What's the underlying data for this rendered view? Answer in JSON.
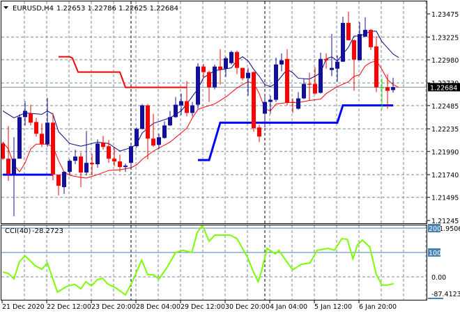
{
  "header": {
    "symbol": "EURUSD,H4",
    "ohlc": "1.22653 1.22786 1.22625 1.22684"
  },
  "chart_data": [
    {
      "type": "candlestick",
      "title": "EURUSD,H4",
      "ylim": [
        1.21245,
        1.23475
      ],
      "price_ticks": [
        "1.23475",
        "1.23225",
        "1.22980",
        "1.22730",
        "1.22485",
        "1.22235",
        "1.21990",
        "1.21740",
        "1.21495",
        "1.21245"
      ],
      "current_price": "1.22684",
      "time_labels": [
        "21 Dec 2020",
        "22 Dec 12:00",
        "23 Dec 20:00",
        "28 Dec 04:00",
        "29 Dec 12:00",
        "30 Dec 20:00",
        "4 Jan 04:00",
        "5 Jan 12:00",
        "6 Jan 20:00"
      ],
      "colors": {
        "bull": "#10109c",
        "bear": "#ff0000",
        "doji": "#33dd22",
        "upper_line": "#000080",
        "lower_line": "#ff0000",
        "step_blue": "#0000ff",
        "step_red": "#ff0000",
        "current": "#7f8fa0"
      },
      "candles": [
        [
          1.22076,
          1.22091,
          1.21897,
          1.21912
        ],
        [
          1.21912,
          1.22264,
          1.21673,
          1.21748
        ],
        [
          1.21748,
          1.22144,
          1.21291,
          1.21912
        ],
        [
          1.21912,
          1.22391,
          1.21912,
          1.22361
        ],
        [
          1.22361,
          1.22533,
          1.22271,
          1.22428
        ],
        [
          1.22398,
          1.22495,
          1.22271,
          1.22301
        ],
        [
          1.22308,
          1.22353,
          1.22151,
          1.22181
        ],
        [
          1.22181,
          1.22293,
          1.22039,
          1.22069
        ],
        [
          1.22069,
          1.2257,
          1.22039,
          1.22301
        ],
        [
          1.22301,
          1.22406,
          1.2168,
          1.2174
        ],
        [
          1.2174,
          1.2174,
          1.21516,
          1.2162
        ],
        [
          1.21605,
          1.21778,
          1.21531,
          1.2177
        ],
        [
          1.2177,
          1.21905,
          1.2174,
          1.2189
        ],
        [
          1.2189,
          1.22009,
          1.21852,
          1.21935
        ],
        [
          1.21935,
          1.21979,
          1.21605,
          1.21763
        ],
        [
          1.21763,
          1.22211,
          1.21733,
          1.21867
        ],
        [
          1.21867,
          1.21964,
          1.21733,
          1.21852
        ],
        [
          1.21852,
          1.22121,
          1.21815,
          1.22076
        ],
        [
          1.22084,
          1.22159,
          1.22009,
          1.22039
        ],
        [
          1.22047,
          1.22114,
          1.21867,
          1.21912
        ],
        [
          1.21912,
          1.22032,
          1.2183,
          1.21882
        ],
        [
          1.21882,
          1.21957,
          1.2177,
          1.21822
        ],
        [
          1.21822,
          1.2186,
          1.2177,
          1.21837
        ],
        [
          1.21867,
          1.22054,
          1.21807,
          1.22047
        ],
        [
          1.22047,
          1.22249,
          1.22032,
          1.22234
        ],
        [
          1.22234,
          1.22503,
          1.22226,
          1.22488
        ],
        [
          1.22488,
          1.22503,
          1.21905,
          1.22129
        ],
        [
          1.22129,
          1.22398,
          1.22039,
          1.22054
        ],
        [
          1.22062,
          1.22181,
          1.22017,
          1.22144
        ],
        [
          1.22136,
          1.22316,
          1.22129,
          1.22271
        ],
        [
          1.22271,
          1.22428,
          1.22264,
          1.22361
        ],
        [
          1.22361,
          1.22578,
          1.22353,
          1.22495
        ],
        [
          1.22488,
          1.22615,
          1.22383,
          1.22533
        ],
        [
          1.22533,
          1.2275,
          1.22368,
          1.22406
        ],
        [
          1.22406,
          1.22525,
          1.22368,
          1.22488
        ],
        [
          1.22495,
          1.22944,
          1.22451,
          1.22907
        ],
        [
          1.22907,
          1.22937,
          1.2278,
          1.22847
        ],
        [
          1.22847,
          1.22862,
          1.22525,
          1.22682
        ],
        [
          1.22682,
          1.22929,
          1.2266,
          1.22907
        ],
        [
          1.22907,
          1.23094,
          1.22712,
          1.22877
        ],
        [
          1.22884,
          1.23012,
          1.22795,
          1.22997
        ],
        [
          1.22944,
          1.23079,
          1.22929,
          1.23064
        ],
        [
          1.23064,
          1.23079,
          1.22825,
          1.22892
        ],
        [
          1.22892,
          1.22892,
          1.22757,
          1.2278
        ],
        [
          1.2278,
          1.22892,
          1.22593,
          1.2284
        ],
        [
          1.22847,
          1.22855,
          1.22204,
          1.22241
        ],
        [
          1.22249,
          1.22279,
          1.22091,
          1.22151
        ],
        [
          1.22398,
          1.22578,
          1.22249,
          1.22525
        ],
        [
          1.22525,
          1.22593,
          1.22398,
          1.22548
        ],
        [
          1.22548,
          1.23004,
          1.22525,
          1.22929
        ],
        [
          1.22929,
          1.23049,
          1.22855,
          1.22974
        ],
        [
          1.22989,
          1.23094,
          1.22488,
          1.22518
        ],
        [
          1.22525,
          1.22563,
          1.22406,
          1.22518
        ],
        [
          1.22451,
          1.2263,
          1.22443,
          1.22563
        ],
        [
          1.22563,
          1.22772,
          1.22555,
          1.2272
        ],
        [
          1.2272,
          1.2284,
          1.2254,
          1.22712
        ],
        [
          1.2272,
          1.22899,
          1.22608,
          1.22615
        ],
        [
          1.22623,
          1.23057,
          1.22615,
          1.22989
        ],
        [
          1.22989,
          1.23049,
          1.22884,
          1.22974
        ],
        [
          1.2287,
          1.23258,
          1.22802,
          1.22892
        ],
        [
          1.22884,
          1.23027,
          1.22742,
          1.22959
        ],
        [
          1.22959,
          1.23445,
          1.22959,
          1.23378
        ],
        [
          1.23378,
          1.23498,
          1.23191,
          1.23191
        ],
        [
          1.23191,
          1.23199,
          1.22645,
          1.22982
        ],
        [
          1.22974,
          1.23386,
          1.22974,
          1.23258
        ],
        [
          1.23229,
          1.23438,
          1.23229,
          1.23303
        ],
        [
          1.23303,
          1.23311,
          1.23086,
          1.23116
        ],
        [
          1.23124,
          1.23236,
          1.2263,
          1.22682
        ],
        [
          1.22682,
          1.2278,
          1.22443,
          1.22682
        ],
        [
          1.22682,
          1.22825,
          1.22451,
          1.22645
        ],
        [
          1.22653,
          1.22786,
          1.22625,
          1.22684
        ]
      ],
      "upper_line": [
        [
          0,
          1.22428
        ],
        [
          2,
          1.22353
        ],
        [
          4,
          1.22406
        ],
        [
          7,
          1.22391
        ],
        [
          8,
          1.22428
        ],
        [
          9,
          1.22391
        ],
        [
          10,
          1.22204
        ],
        [
          12,
          1.22076
        ],
        [
          14,
          1.22047
        ],
        [
          17,
          1.22091
        ],
        [
          19,
          1.22076
        ],
        [
          21,
          1.21994
        ],
        [
          23,
          1.22032
        ],
        [
          24,
          1.22069
        ],
        [
          25,
          1.22189
        ],
        [
          27,
          1.22293
        ],
        [
          30,
          1.22353
        ],
        [
          32,
          1.22428
        ],
        [
          33,
          1.22503
        ],
        [
          35,
          1.22667
        ],
        [
          36,
          1.22787
        ],
        [
          38,
          1.22862
        ],
        [
          41,
          1.22892
        ],
        [
          42,
          1.22974
        ],
        [
          43,
          1.23012
        ],
        [
          44,
          1.22967
        ],
        [
          45,
          1.22877
        ],
        [
          46,
          1.22802
        ],
        [
          47,
          1.22712
        ],
        [
          48,
          1.2269
        ],
        [
          49,
          1.22727
        ],
        [
          51,
          1.22877
        ],
        [
          52,
          1.2284
        ],
        [
          53,
          1.2278
        ],
        [
          55,
          1.22772
        ],
        [
          56,
          1.22802
        ],
        [
          57,
          1.2284
        ],
        [
          58,
          1.22989
        ],
        [
          59,
          1.23012
        ],
        [
          60,
          1.22967
        ],
        [
          62,
          1.23116
        ],
        [
          63,
          1.23236
        ],
        [
          64,
          1.23236
        ],
        [
          66,
          1.23288
        ],
        [
          67,
          1.23288
        ],
        [
          68,
          1.23176
        ],
        [
          70,
          1.23042
        ],
        [
          71,
          1.23004
        ]
      ],
      "lower_line": [
        [
          0,
          1.22091
        ],
        [
          1,
          1.22017
        ],
        [
          2,
          1.21845
        ],
        [
          3,
          1.2177
        ],
        [
          4,
          1.21867
        ],
        [
          5,
          1.22017
        ],
        [
          6,
          1.22069
        ],
        [
          8,
          1.22069
        ],
        [
          9,
          1.22039
        ],
        [
          10,
          1.2189
        ],
        [
          11,
          1.2177
        ],
        [
          12,
          1.21733
        ],
        [
          14,
          1.2171
        ],
        [
          15,
          1.21703
        ],
        [
          17,
          1.2174
        ],
        [
          19,
          1.21785
        ],
        [
          21,
          1.21792
        ],
        [
          23,
          1.21815
        ],
        [
          24,
          1.21845
        ],
        [
          25,
          1.21905
        ],
        [
          27,
          1.21994
        ],
        [
          30,
          1.22091
        ],
        [
          33,
          1.22241
        ],
        [
          34,
          1.22353
        ],
        [
          35,
          1.22443
        ],
        [
          36,
          1.22466
        ],
        [
          38,
          1.22503
        ],
        [
          40,
          1.22578
        ],
        [
          42,
          1.22675
        ],
        [
          43,
          1.22712
        ],
        [
          44,
          1.22742
        ],
        [
          45,
          1.22727
        ],
        [
          46,
          1.22615
        ],
        [
          47,
          1.22451
        ],
        [
          48,
          1.22428
        ],
        [
          49,
          1.22503
        ],
        [
          51,
          1.22518
        ],
        [
          53,
          1.22518
        ],
        [
          55,
          1.2254
        ],
        [
          57,
          1.22555
        ],
        [
          58,
          1.22615
        ],
        [
          59,
          1.22653
        ],
        [
          60,
          1.2269
        ],
        [
          62,
          1.22742
        ],
        [
          63,
          1.22802
        ],
        [
          64,
          1.22817
        ],
        [
          65,
          1.22914
        ],
        [
          66,
          1.22952
        ],
        [
          67,
          1.22967
        ],
        [
          68,
          1.22877
        ],
        [
          69,
          1.22765
        ],
        [
          70,
          1.22712
        ],
        [
          71,
          1.22682
        ]
      ],
      "step_red": [
        [
          10,
          1.23012
        ],
        [
          12,
          1.23012
        ],
        [
          12.5,
          1.22997
        ],
        [
          13.5,
          1.22847
        ],
        [
          21,
          1.22847
        ],
        [
          22,
          1.22682
        ],
        [
          33,
          1.22682
        ]
      ],
      "step_blue_1": [
        [
          0,
          1.2174
        ],
        [
          9,
          1.2174
        ]
      ],
      "step_blue_2": [
        [
          35,
          1.21897
        ],
        [
          37,
          1.21897
        ],
        [
          39,
          1.22301
        ],
        [
          60,
          1.22301
        ],
        [
          61,
          1.22488
        ],
        [
          70,
          1.22488
        ]
      ]
    },
    {
      "type": "line",
      "title": "CCI(40)",
      "value_label": "-28.2723",
      "ylim": [
        -87.4123,
        211.9506
      ],
      "levels": [
        "200",
        "100"
      ],
      "zero_label": "0.00",
      "max_label": "211.9506",
      "min_label": "-87.4123",
      "color": "#7cfc00",
      "points": [
        [
          0,
          20
        ],
        [
          1,
          14
        ],
        [
          2,
          -9
        ],
        [
          3,
          63
        ],
        [
          4,
          86
        ],
        [
          5.8,
          46
        ],
        [
          7,
          31
        ],
        [
          8,
          57
        ],
        [
          9.8,
          -63
        ],
        [
          11.4,
          -40
        ],
        [
          12.9,
          -31
        ],
        [
          14,
          -49
        ],
        [
          14.9,
          -20
        ],
        [
          15.9,
          -37
        ],
        [
          17,
          -11
        ],
        [
          17.9,
          -6
        ],
        [
          18.9,
          -31
        ],
        [
          20.1,
          -43
        ],
        [
          22,
          -74
        ],
        [
          23.3,
          -17
        ],
        [
          24.9,
          69
        ],
        [
          26,
          9
        ],
        [
          27,
          9
        ],
        [
          28,
          -9
        ],
        [
          29.5,
          40
        ],
        [
          31,
          100
        ],
        [
          32.3,
          109
        ],
        [
          33.9,
          100
        ],
        [
          34.9,
          183
        ],
        [
          35.8,
          212
        ],
        [
          37,
          146
        ],
        [
          38,
          171
        ],
        [
          39.5,
          171
        ],
        [
          40.8,
          171
        ],
        [
          42,
          157
        ],
        [
          43.9,
          80
        ],
        [
          44.9,
          23
        ],
        [
          45.8,
          -20
        ],
        [
          46.4,
          23
        ],
        [
          47.4,
          117
        ],
        [
          48.9,
          94
        ],
        [
          49.5,
          109
        ],
        [
          50.8,
          66
        ],
        [
          52,
          29
        ],
        [
          53.5,
          51
        ],
        [
          55.1,
          57
        ],
        [
          56.4,
          109
        ],
        [
          58.3,
          117
        ],
        [
          59.5,
          109
        ],
        [
          60.8,
          157
        ],
        [
          61.8,
          154
        ],
        [
          62.8,
          74
        ],
        [
          63.6,
          131
        ],
        [
          64.5,
          151
        ],
        [
          65.8,
          123
        ],
        [
          67,
          9
        ],
        [
          68,
          -34
        ],
        [
          69,
          -34
        ],
        [
          70.1,
          -28.27
        ]
      ]
    }
  ]
}
